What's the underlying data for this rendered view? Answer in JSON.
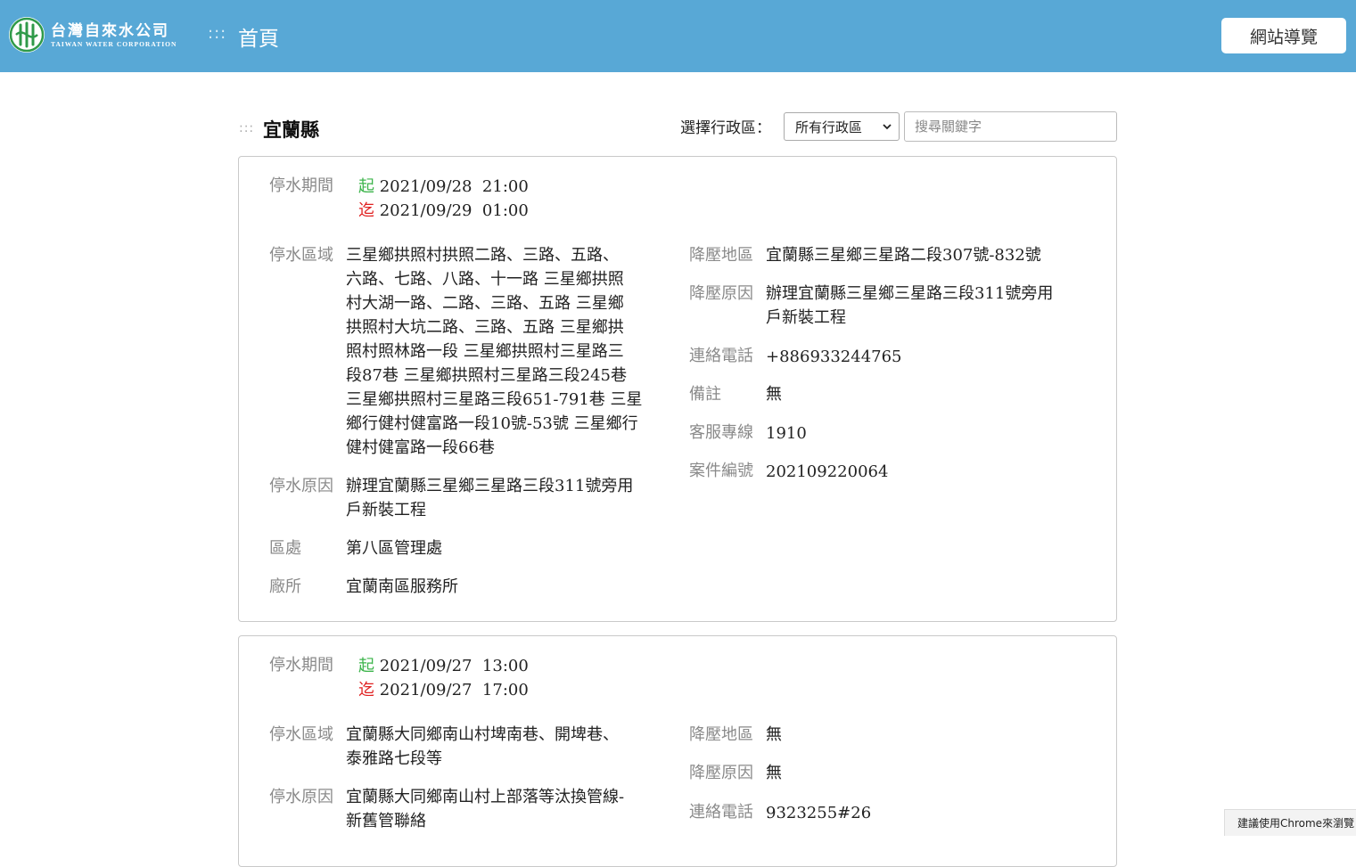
{
  "header": {
    "logo_zh": "台灣自來水公司",
    "logo_en": "TAIWAN WATER CORPORATION",
    "breadcrumb_dots": ":::",
    "home_label": "首頁",
    "sitemap_label": "網站導覽"
  },
  "filter": {
    "section_dots": ":::",
    "title": "宜蘭縣",
    "district_label": "選擇行政區：",
    "district_selected": "所有行政區",
    "search_placeholder": "搜尋關鍵字"
  },
  "labels": {
    "period": "停水期間",
    "start": "起",
    "end": "迄",
    "area": "停水區域",
    "reason": "停水原因",
    "branch": "區處",
    "office": "廠所",
    "pressure_area": "降壓地區",
    "pressure_reason": "降壓原因",
    "phone": "連絡電話",
    "remark": "備註",
    "hotline": "客服專線",
    "case_no": "案件編號"
  },
  "notices": [
    {
      "start": "2021/09/28  21:00",
      "end": "2021/09/29  01:00",
      "area_lines": [
        "三星鄉拱照村拱照二路、三路、五路、",
        "六路、七路、八路、十一路 三星鄉拱照",
        "村大湖一路、二路、三路、五路 三星鄉",
        "拱照村大坑二路、三路、五路 三星鄉拱",
        "照村照林路一段 三星鄉拱照村三星路三",
        "段87巷 三星鄉拱照村三星路三段245巷",
        "三星鄉拱照村三星路三段651-791巷 三星",
        "鄉行健村健富路一段10號-53號 三星鄉行",
        "健村健富路一段66巷"
      ],
      "reason_lines": [
        "辦理宜蘭縣三星鄉三星路三段311號旁用",
        "戶新裝工程"
      ],
      "branch": "第八區管理處",
      "office": "宜蘭南區服務所",
      "pressure_area": "宜蘭縣三星鄉三星路二段307號-832號",
      "pressure_reason_lines": [
        "辦理宜蘭縣三星鄉三星路三段311號旁用",
        "戶新裝工程"
      ],
      "phone": "+886933244765",
      "remark": "無",
      "hotline": "1910",
      "case_no": "202109220064"
    },
    {
      "start": "2021/09/27  13:00",
      "end": "2021/09/27  17:00",
      "area_lines": [
        "宜蘭縣大同鄉南山村埤南巷、開埤巷、",
        "泰雅路七段等"
      ],
      "reason_lines": [
        "宜蘭縣大同鄉南山村上部落等汰換管線-",
        "新舊管聯絡"
      ],
      "pressure_area": "無",
      "pressure_reason": "無",
      "phone": "9323255#26"
    }
  ],
  "footer_note": "建議使用Chrome來瀏覽"
}
